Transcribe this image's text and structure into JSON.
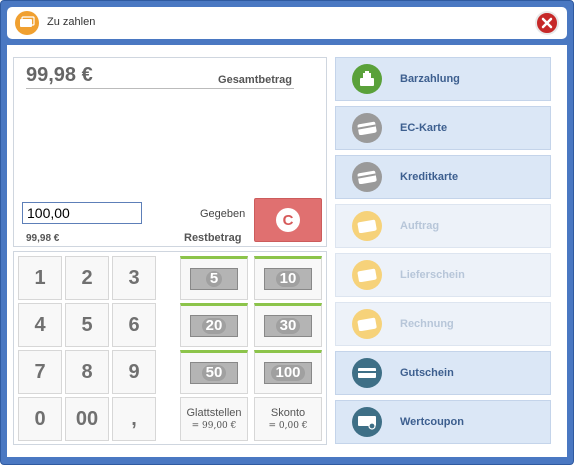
{
  "window": {
    "title": "Zu zahlen"
  },
  "summary": {
    "total_amount": "99,98 €",
    "total_label": "Gesamtbetrag",
    "given_value": "100,00",
    "given_label": "Gegeben",
    "clear_label": "C",
    "rest_amount": "99,98 €",
    "rest_label": "Restbetrag"
  },
  "keypad": {
    "keys": [
      "1",
      "2",
      "3",
      "4",
      "5",
      "6",
      "7",
      "8",
      "9",
      "0",
      "00",
      ","
    ]
  },
  "money": {
    "notes": [
      "5",
      "10",
      "20",
      "30",
      "50",
      "100"
    ]
  },
  "functions": {
    "round_label": "Glattstellen",
    "round_value": "= 99,00 €",
    "discount_label": "Skonto",
    "discount_value": "= 0,00 €"
  },
  "payments": [
    {
      "label": "Barzahlung",
      "icon": "cash-register-icon",
      "color": "#5aa13a",
      "enabled": true
    },
    {
      "label": "EC-Karte",
      "icon": "card-icon",
      "color": "#9a9a9a",
      "enabled": true
    },
    {
      "label": "Kreditkarte",
      "icon": "card-icon",
      "color": "#9a9a9a",
      "enabled": true
    },
    {
      "label": "Auftrag",
      "icon": "document-icon",
      "color": "#f6d27a",
      "enabled": false
    },
    {
      "label": "Lieferschein",
      "icon": "document-icon",
      "color": "#f6d27a",
      "enabled": false
    },
    {
      "label": "Rechnung",
      "icon": "document-icon",
      "color": "#f6d27a",
      "enabled": false
    },
    {
      "label": "Gutschein",
      "icon": "voucher-icon",
      "color": "#3e6f86",
      "enabled": true
    },
    {
      "label": "Wertcoupon",
      "icon": "coupon-icon",
      "color": "#3e6f86",
      "enabled": true
    }
  ],
  "colors": {
    "window_border": "#4a78c2",
    "clear_button": "#e07070",
    "payment_bg": "#dbe7f6",
    "note_accent": "#8cc44a"
  }
}
